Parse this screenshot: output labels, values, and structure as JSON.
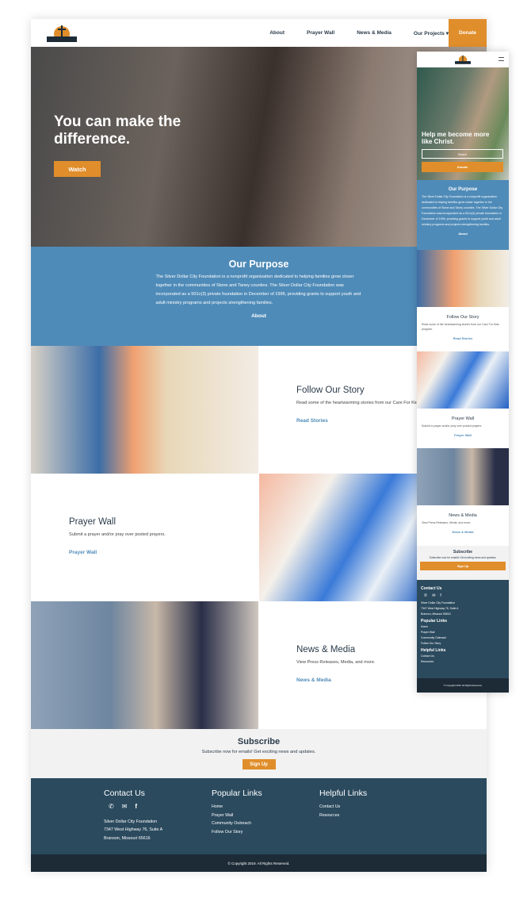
{
  "brand": {
    "logo_text": "Silver Dollar City Foundation",
    "accent": "#e08e2b",
    "blue": "#4f8bb8",
    "footer": "#2b4a5e"
  },
  "nav": {
    "items": [
      "About",
      "Prayer Wall",
      "News & Media",
      "Our Projects ▾"
    ],
    "donate": "Donate"
  },
  "hero": {
    "title": "You can make the difference.",
    "watch": "Watch"
  },
  "purpose": {
    "title": "Our Purpose",
    "body": "The Silver Dollar City Foundation is a nonprofit organization dedicated to helping families grow closer together in the communities of Stone and Taney counties. The Silver Dollar City Foundation was incorporated as a 501c(3) private foundation in December of 1996, providing grants to support youth and adult ministry programs and projects strengthening families.",
    "link": "About"
  },
  "story": {
    "title": "Follow Our Story",
    "body": "Read some of the heartwarming stories from our Care For Kids program.",
    "link": "Read Stories"
  },
  "prayer": {
    "title": "Prayer Wall",
    "body": "Submit a prayer and/or pray over posted prayers.",
    "link": "Prayer Wall"
  },
  "news": {
    "title": "News & Media",
    "body": "View Press Releases, Media, and more.",
    "link": "News & Media"
  },
  "subscribe": {
    "title": "Subscribe",
    "body": "Subscribe now for emails! Get exciting news and updates.",
    "button": "Sign Up"
  },
  "footer": {
    "contact_title": "Contact Us",
    "address": [
      "Silver Dollar City Foundation",
      "7347 West Highway 76, Suite A",
      "Branson, Missouri 65616"
    ],
    "popular_title": "Popular Links",
    "popular": [
      "Home",
      "Prayer Wall",
      "Community Outreach",
      "Follow Our Story"
    ],
    "helpful_title": "Helpful Links",
    "helpful": [
      "Contact Us",
      "Resources"
    ],
    "copyright": "© Copyright 2019. All Rights Reserved."
  },
  "mobile": {
    "hero_title": "Help me become more like Christ.",
    "watch": "Watch",
    "donate": "Donate"
  }
}
